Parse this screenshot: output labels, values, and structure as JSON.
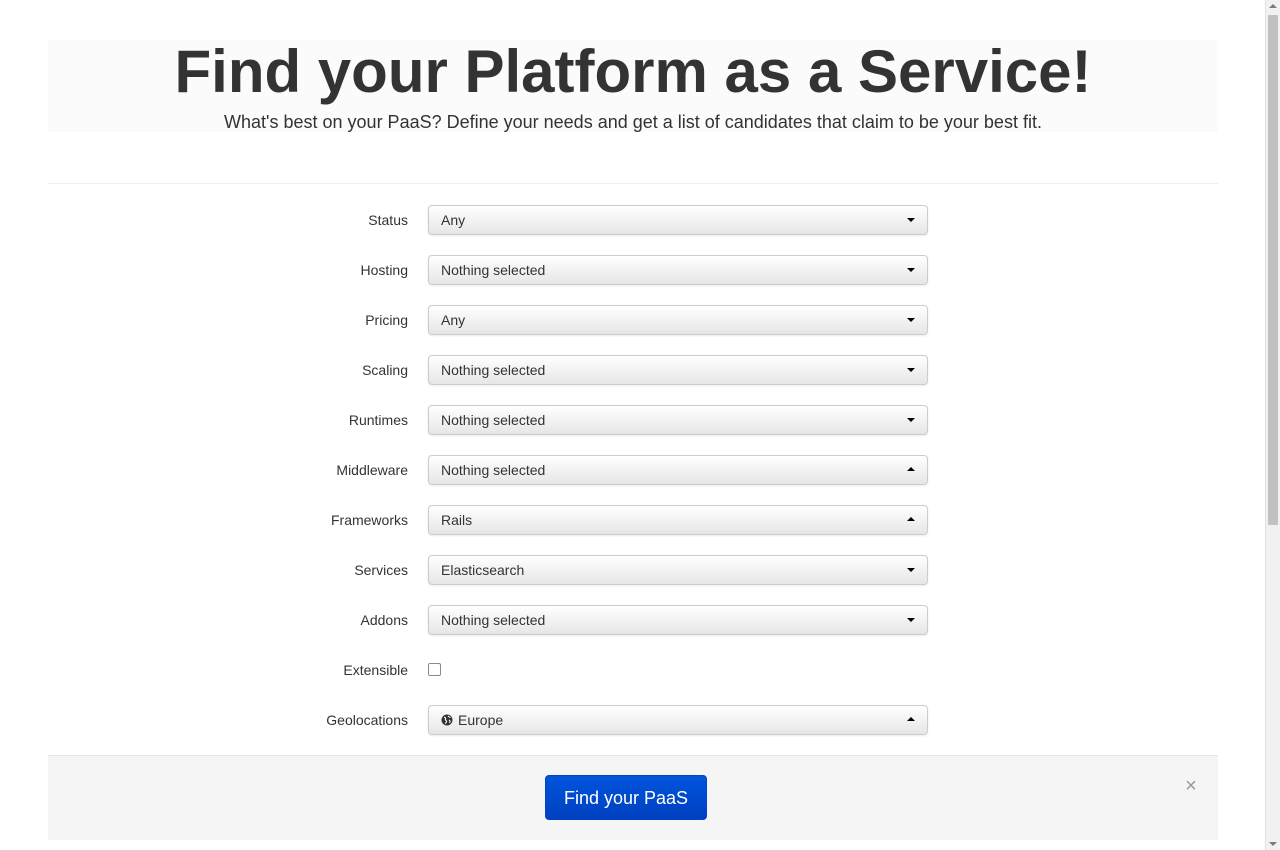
{
  "header": {
    "title": "Find your Platform as a Service!",
    "subtitle": "What's best on your PaaS? Define your needs and get a list of candidates that claim to be your best fit."
  },
  "form": {
    "status": {
      "label": "Status",
      "value": "Any",
      "caret": "down"
    },
    "hosting": {
      "label": "Hosting",
      "value": "Nothing selected",
      "caret": "down"
    },
    "pricing": {
      "label": "Pricing",
      "value": "Any",
      "caret": "down"
    },
    "scaling": {
      "label": "Scaling",
      "value": "Nothing selected",
      "caret": "down"
    },
    "runtimes": {
      "label": "Runtimes",
      "value": "Nothing selected",
      "caret": "down"
    },
    "middleware": {
      "label": "Middleware",
      "value": "Nothing selected",
      "caret": "up"
    },
    "frameworks": {
      "label": "Frameworks",
      "value": "Rails",
      "caret": "up"
    },
    "services": {
      "label": "Services",
      "value": "Elasticsearch",
      "caret": "down"
    },
    "addons": {
      "label": "Addons",
      "value": "Nothing selected",
      "caret": "down"
    },
    "extensible": {
      "label": "Extensible",
      "checked": false
    },
    "geolocations": {
      "label": "Geolocations",
      "value": "Europe",
      "icon": "globe-icon",
      "caret": "up"
    }
  },
  "actions": {
    "submit_label": "Find your PaaS",
    "close_label": "×"
  },
  "colors": {
    "primary_button": "#0048d0",
    "title_text": "#333333"
  }
}
